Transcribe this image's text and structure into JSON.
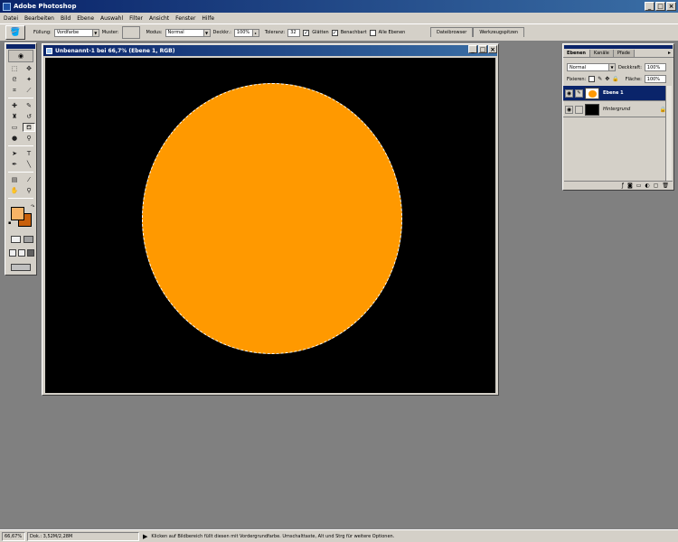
{
  "app": {
    "title": "Adobe Photoshop"
  },
  "menu": [
    "Datei",
    "Bearbeiten",
    "Bild",
    "Ebene",
    "Auswahl",
    "Filter",
    "Ansicht",
    "Fenster",
    "Hilfe"
  ],
  "options": {
    "fill_label": "Füllung:",
    "fill_value": "Vordfarbe",
    "pattern_label": "Muster:",
    "mode_label": "Modus:",
    "mode_value": "Normal",
    "opacity_label": "Deckkr.:",
    "opacity_value": "100%",
    "tolerance_label": "Toleranz:",
    "tolerance_value": "32",
    "antialias_label": "Glätten",
    "contiguous_label": "Benachbart",
    "all_layers_label": "Alle Ebenen",
    "tab_filebrowser": "Dateibrowser",
    "tab_presets": "Werkzeugspitzen"
  },
  "document": {
    "title": "Unbenannt-1 bei 66,7% (Ebene 1, RGB)",
    "background_color": "#000000",
    "shape_color": "#ff9900"
  },
  "colors": {
    "foreground": "#f8b366",
    "background": "#c9600c"
  },
  "layers_panel": {
    "tabs": [
      "Ebenen",
      "Kanäle",
      "Pfade"
    ],
    "blend_mode": "Normal",
    "opacity_label": "Deckkraft:",
    "opacity_value": "100%",
    "lock_label": "Fixieren:",
    "fill_label": "Fläche:",
    "fill_value": "100%",
    "layers": [
      {
        "name": "Ebene 1",
        "selected": true
      },
      {
        "name": "Hintergrund",
        "selected": false
      }
    ]
  },
  "status": {
    "zoom": "66,67%",
    "doc": "Dok.: 3,52M/2,28M",
    "hint": "Klicken auf Bildbereich füllt diesen mit Vordergrundfarbe. Umschalttaste, Alt und Strg für weitere Optionen."
  }
}
